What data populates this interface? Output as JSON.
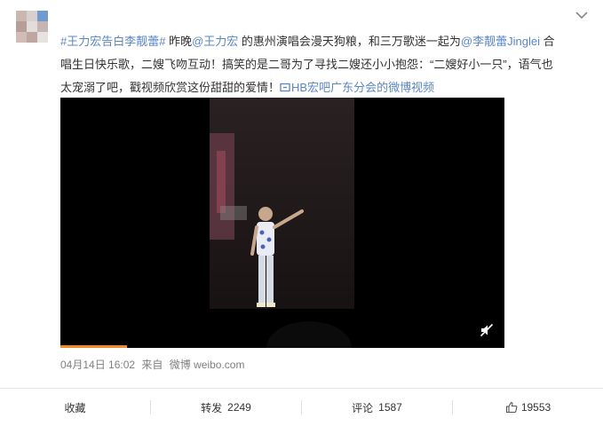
{
  "post": {
    "hashtag": "#王力宏告白李靓蕾#",
    "text_1": " 昨晚",
    "mention_1": "@王力宏",
    "text_2": " 的惠州演唱会漫天狗粮，和三万歌迷一起为",
    "mention_2": "@李靓蕾Jinglei",
    "text_3": " 合唱生日快乐歌，二嫂飞吻互动！搞笑的是二哥为了寻找二嫂还小小抱怨：“二嫂好小一只”，语气也太宠溺了吧，戳视频欣赏这份甜甜的爱情！",
    "source_link": "HB宏吧广东分会的微博视频"
  },
  "meta": {
    "date": "04月14日 16:02",
    "via": "来自",
    "source": "微博 weibo.com"
  },
  "actions": {
    "favorite_label": "收藏",
    "repost_label": "转发",
    "repost_count": "2249",
    "comment_label": "评论",
    "comment_count": "1587",
    "like_count": "19553"
  },
  "video": {
    "progress": 0.15
  },
  "icons": [
    "chevron-down-icon",
    "video-link-icon",
    "mute-icon",
    "thumbs-up-icon"
  ],
  "colors": {
    "link": "#5a86c4",
    "progress": "#f28a26",
    "meta": "#808080"
  }
}
